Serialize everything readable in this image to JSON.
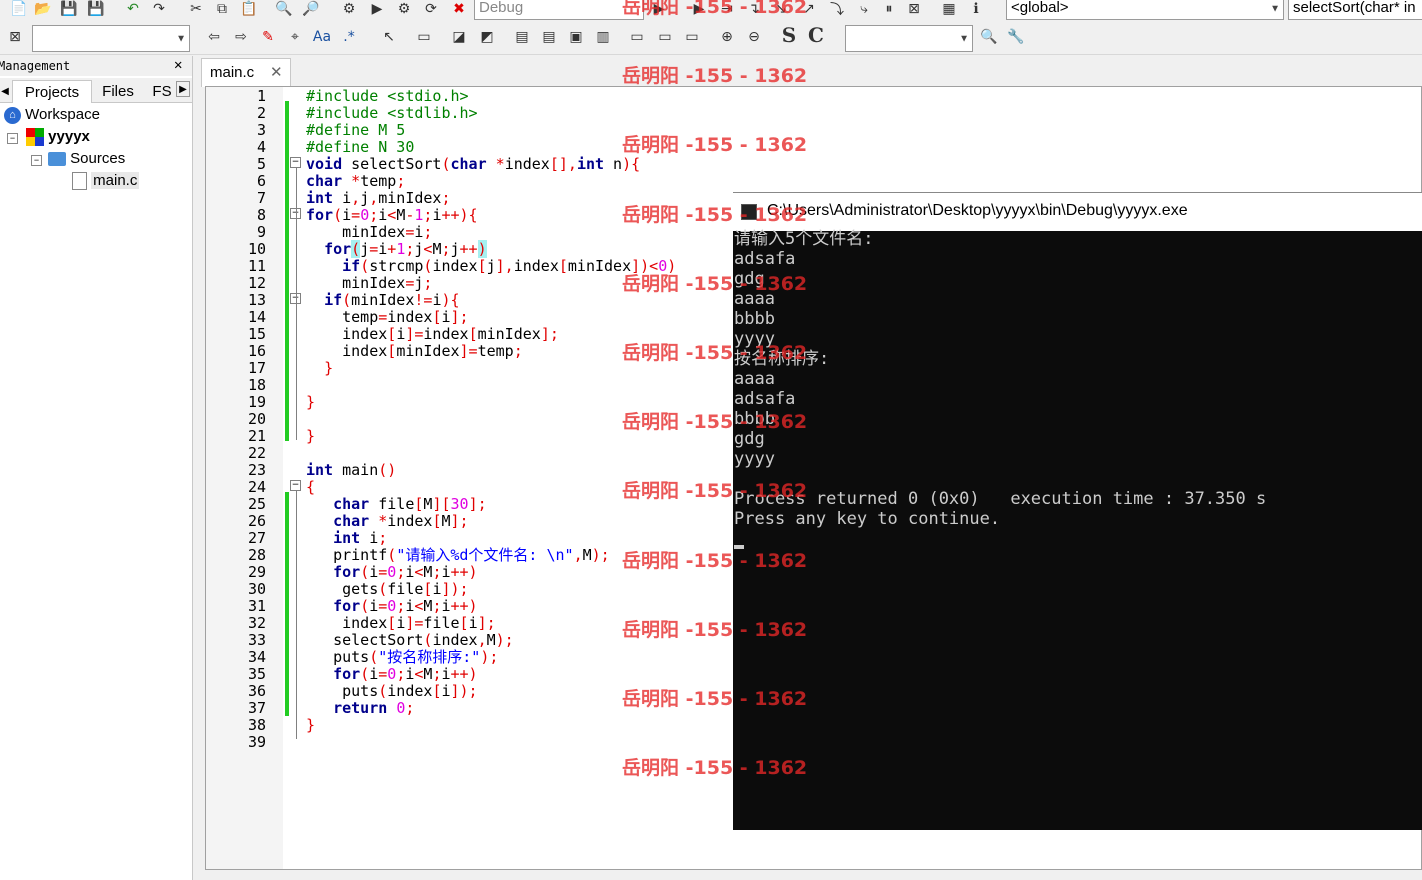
{
  "toolbar": {
    "build_target": "Debug",
    "scope": "<global>",
    "function": "selectSort(char* in",
    "search_value": "",
    "find_value": ""
  },
  "management": {
    "title": "Management",
    "tabs": [
      "Projects",
      "Files",
      "FS"
    ],
    "tree": {
      "workspace": "Workspace",
      "project": "yyyyx",
      "sources": "Sources",
      "file": "main.c"
    }
  },
  "editor": {
    "tab_label": "main.c",
    "line_numbers": [
      "1",
      "2",
      "3",
      "4",
      "5",
      "6",
      "7",
      "8",
      "9",
      "10",
      "11",
      "12",
      "13",
      "14",
      "15",
      "16",
      "17",
      "18",
      "19",
      "20",
      "21",
      "22",
      "23",
      "24",
      "25",
      "26",
      "27",
      "28",
      "29",
      "30",
      "31",
      "32",
      "33",
      "34",
      "35",
      "36",
      "37",
      "38",
      "39"
    ]
  },
  "console": {
    "title": "C:\\Users\\Administrator\\Desktop\\yyyyx\\bin\\Debug\\yyyyx.exe",
    "lines": [
      "请输入5个文件名:",
      "adsafa",
      "gdg",
      "aaaa",
      "bbbb",
      "yyyy",
      "按名称排序:",
      "aaaa",
      "adsafa",
      "bbbb",
      "gdg",
      "yyyy",
      "",
      "Process returned 0 (0x0)   execution time : 37.350 s",
      "Press any key to continue."
    ]
  },
  "watermark": "岳明阳 -155 - 1362",
  "colors": {
    "keyword": "#00008b",
    "preprocessor": "#008000",
    "operator": "#e00000",
    "number": "#e000e0",
    "string": "#0000ff",
    "change_bar": "#22cc22",
    "console_bg": "#0c0c0c",
    "watermark": "#e62828"
  }
}
